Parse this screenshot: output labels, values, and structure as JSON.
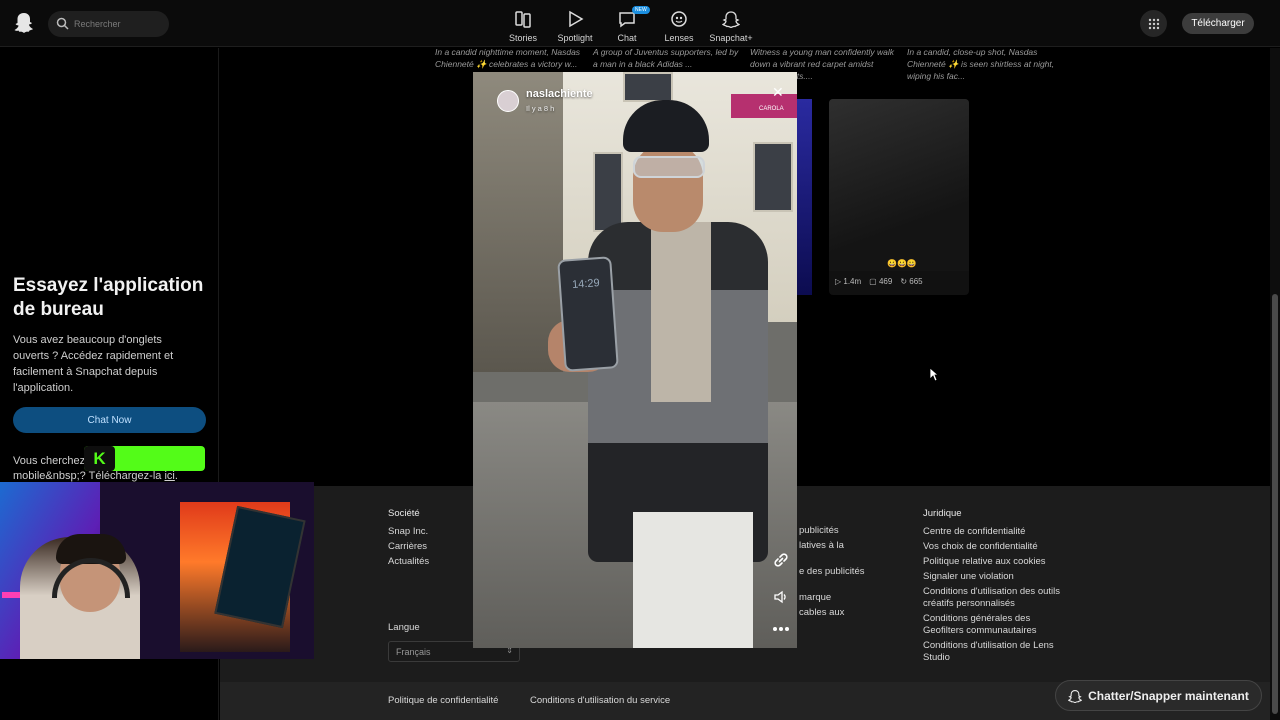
{
  "header": {
    "search_placeholder": "Rechercher",
    "nav": [
      {
        "label": "Stories"
      },
      {
        "label": "Spotlight"
      },
      {
        "label": "Chat",
        "badge": "NEW"
      },
      {
        "label": "Lenses"
      },
      {
        "label": "Snapchat+"
      }
    ],
    "download_label": "Télécharger"
  },
  "left_panel": {
    "title": "Essayez l'application de bureau",
    "text": "Vous avez beaucoup d'onglets ouverts ? Accédez rapidement et facilement à Snapchat depuis l'application.",
    "chat_now_label": "Chat Now",
    "mobile_prefix": "Vous cherchez",
    "mobile_mid": "mobile&nbsp;? Téléchargez-la",
    "mobile_link": "ici",
    "mobile_suffix": "."
  },
  "captions": [
    {
      "text": "In a candid nighttime moment, Nasdas Chienneté ✨ celebrates a victory w..."
    },
    {
      "text": "A group of Juventus supporters, led by a man in a black Adidas ..."
    },
    {
      "text": "Witness a young man confidently walk down a vibrant red carpet amidst dazzling lights...."
    },
    {
      "text": "In a candid, close-up shot, Nasdas Chienneté ✨ is seen shirtless at night, wiping his fac..."
    }
  ],
  "thumbnail": {
    "emoji": "😀😀😀",
    "views": "1.4m",
    "comments": "469",
    "shares": "665"
  },
  "video": {
    "username": "naslachiente",
    "time_ago": "Il y a 8 h",
    "phone_time": "14:29",
    "sign_text": "CAROLA"
  },
  "footer": {
    "societe_head": "Société",
    "societe_items": [
      "Snap Inc.",
      "Carrières",
      "Actualités"
    ],
    "pub_items": [
      "publicités",
      "latives à la",
      "e des publicités",
      "marque",
      "cables aux"
    ],
    "juridique_head": "Juridique",
    "juridique_items": [
      "Centre de confidentialité",
      "Vos choix de confidentialité",
      "Politique relative aux cookies",
      "Signaler une violation",
      "Conditions d'utilisation des outils créatifs personnalisés",
      "Conditions générales des Geofilters communautaires",
      "Conditions d'utilisation de Lens Studio"
    ],
    "langue_head": "Langue",
    "langue_value": "Français",
    "bottom_links": [
      "Politique de confidentialité",
      "Conditions d'utilisation du service"
    ],
    "chat_snap_label": "Chatter/Snapper maintenant"
  },
  "colors": {
    "accent_blue": "#0d4e80",
    "kick_green": "#53fc18",
    "badge_blue": "#1b8fe0"
  }
}
